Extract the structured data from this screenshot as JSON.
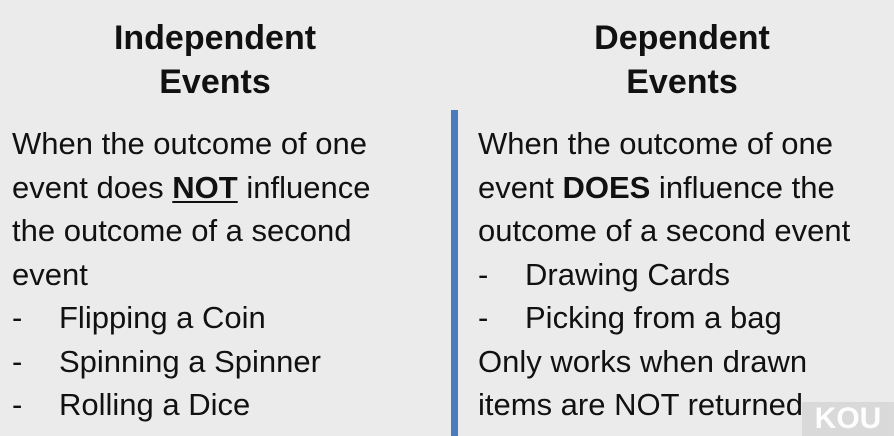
{
  "left": {
    "heading": [
      "Independent",
      "Events"
    ],
    "definition": {
      "l1": "When the outcome of one",
      "l2_pre": "event does ",
      "l2_em": "NOT",
      "l2_post": " influence",
      "l3": "the outcome of a second",
      "l4": "event"
    },
    "examples": [
      "Flipping a Coin",
      "Spinning a Spinner",
      "Rolling a Dice"
    ]
  },
  "right": {
    "heading": [
      "Dependent",
      "Events"
    ],
    "definition": {
      "l1": "When the outcome of one",
      "l2_pre": "event ",
      "l2_em": "DOES",
      "l2_post": " influence the",
      "l3": "outcome of a second event"
    },
    "examples": [
      "Drawing Cards",
      "Picking from a bag"
    ],
    "note": [
      "Only works when drawn",
      "items are NOT returned"
    ]
  },
  "bullet_symbol": "-",
  "watermark": "KOU",
  "colors": {
    "background": "#ebebeb",
    "divider": "#4a7bbd",
    "text": "#111111"
  }
}
